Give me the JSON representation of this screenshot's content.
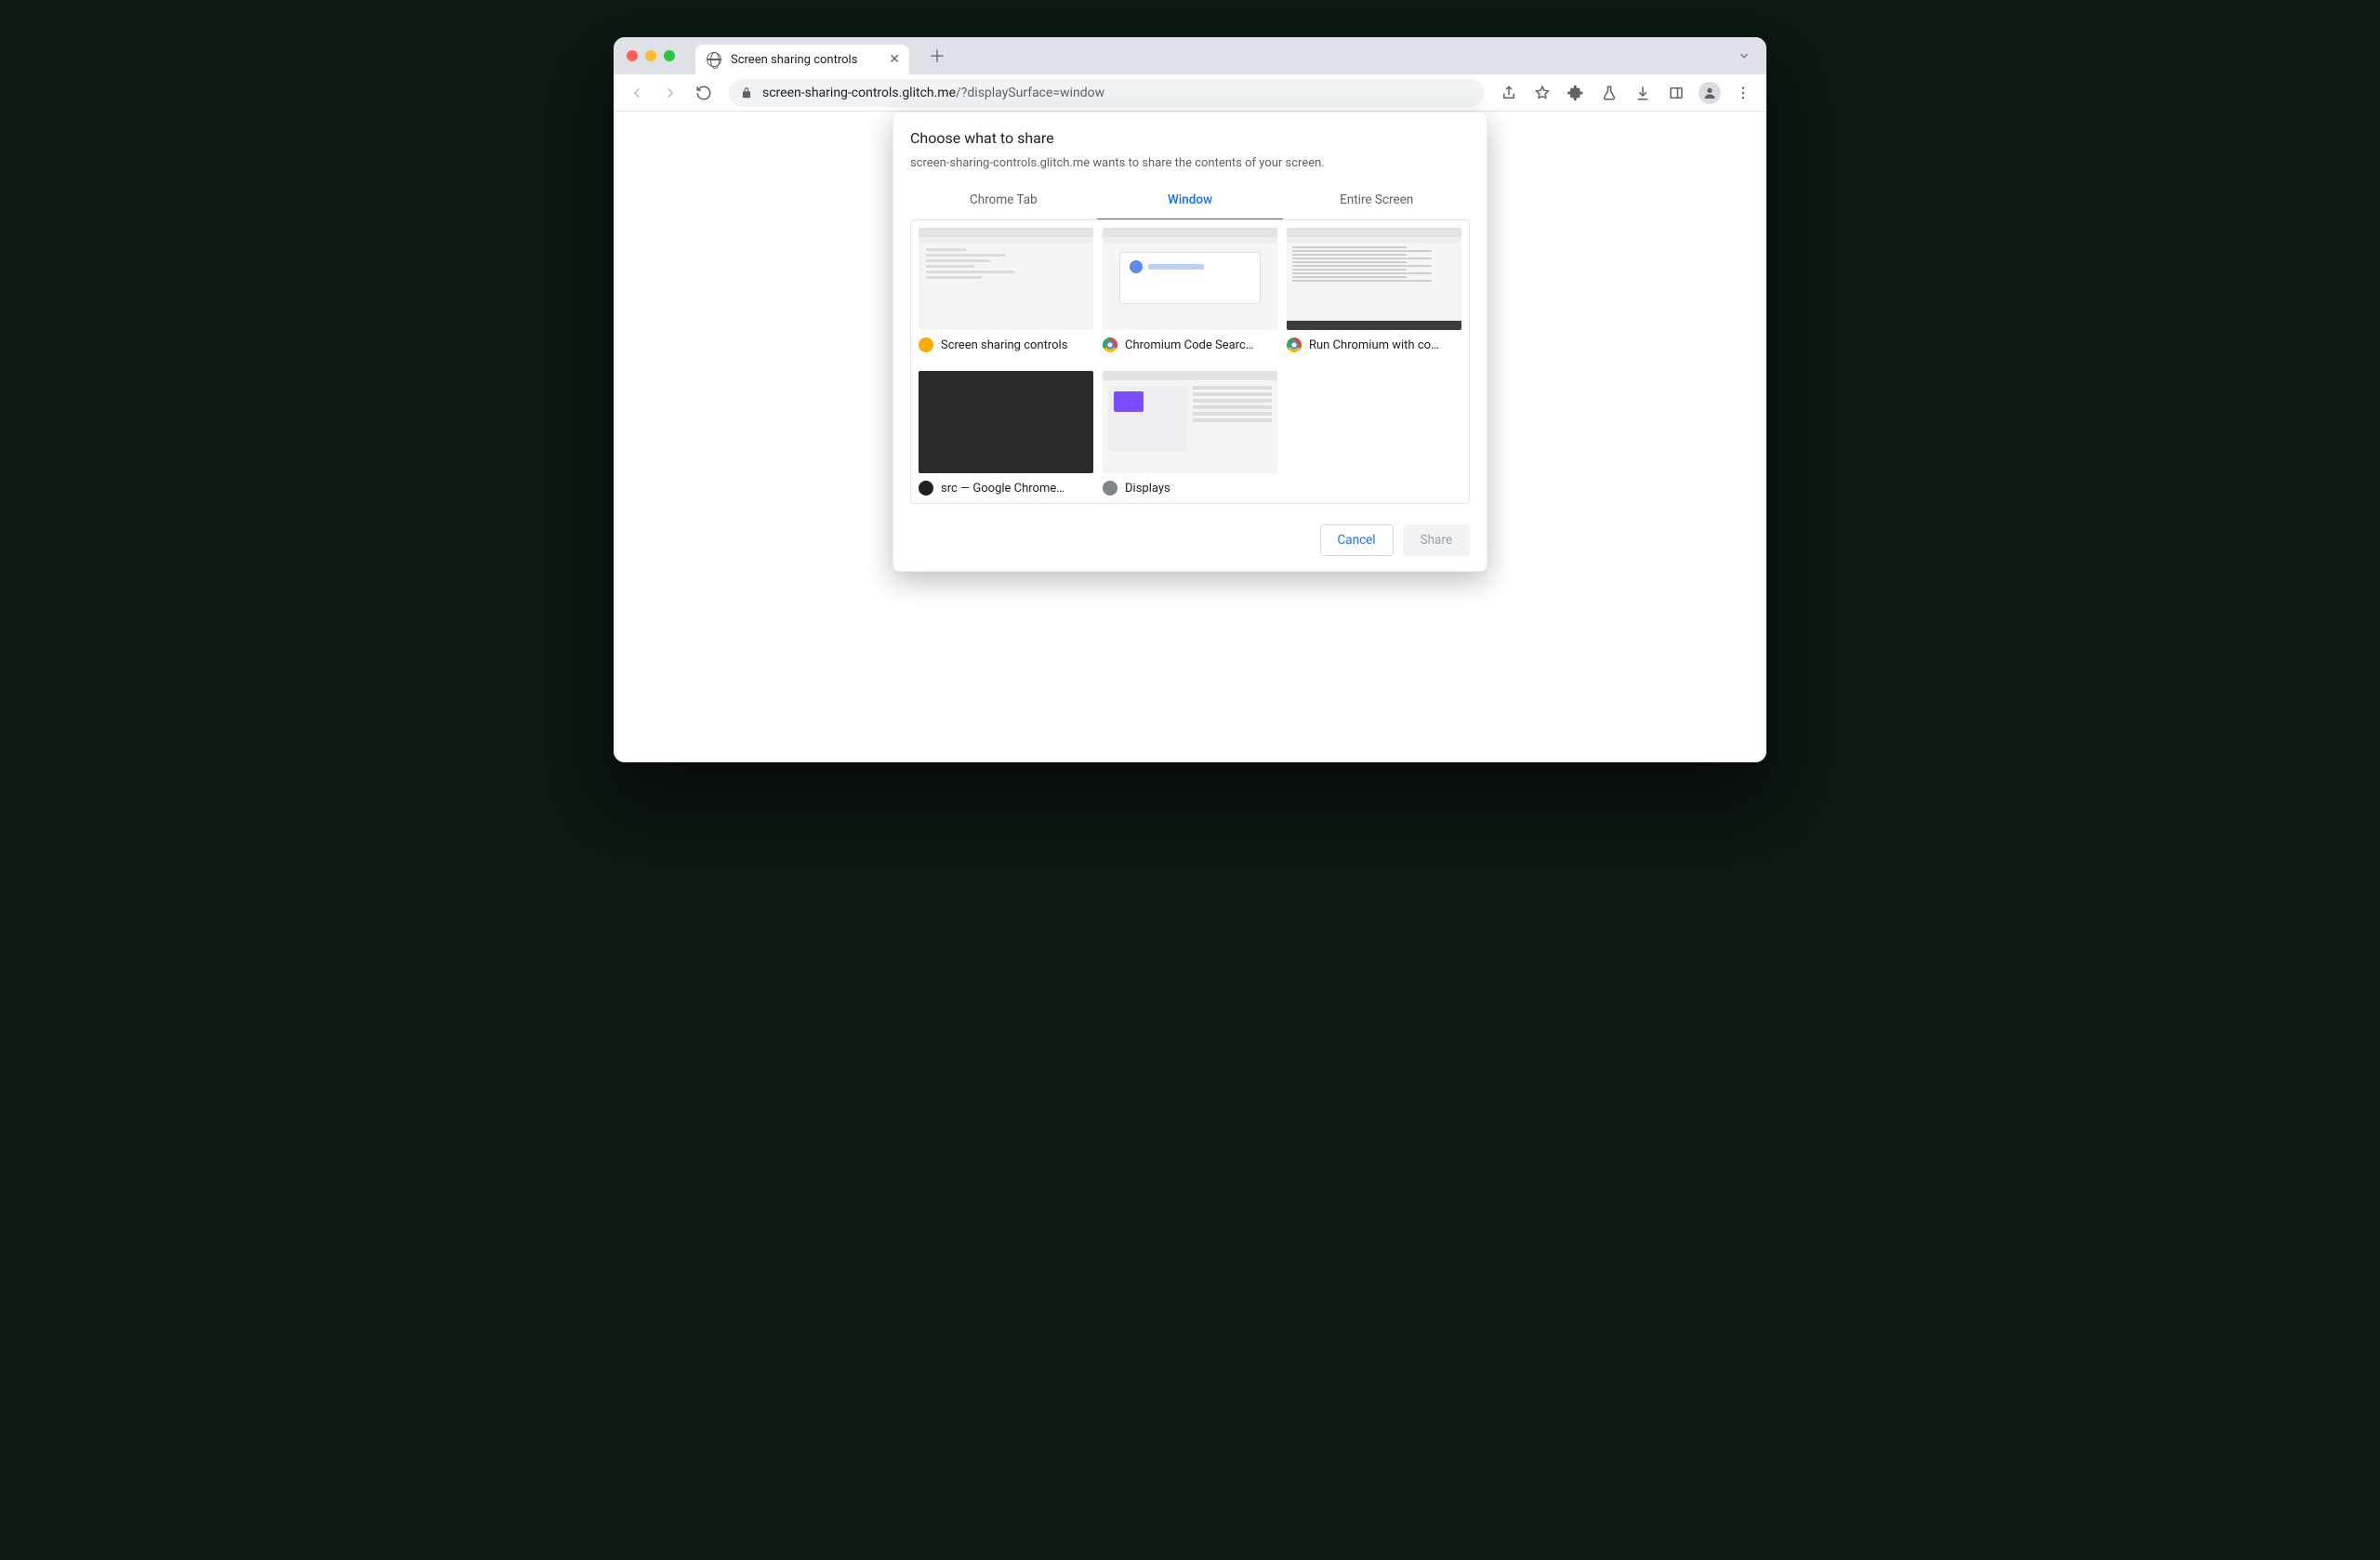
{
  "tab": {
    "title": "Screen sharing controls"
  },
  "url": {
    "host": "screen-sharing-controls.glitch.me",
    "path": "/?displaySurface=window"
  },
  "dialog": {
    "title": "Choose what to share",
    "subtitle": "screen-sharing-controls.glitch.me wants to share the contents of your screen.",
    "tabs": {
      "chrome_tab": "Chrome Tab",
      "window": "Window",
      "entire_screen": "Entire Screen",
      "active": "window"
    },
    "items": [
      {
        "label": "Screen sharing controls",
        "icon": "orange"
      },
      {
        "label": "Chromium Code Searc…",
        "icon": "chrome"
      },
      {
        "label": "Run Chromium with co…",
        "icon": "chrome"
      },
      {
        "label": "src — Google Chrome…",
        "icon": "black"
      },
      {
        "label": "Displays",
        "icon": "grey"
      }
    ],
    "buttons": {
      "cancel": "Cancel",
      "share": "Share"
    }
  }
}
